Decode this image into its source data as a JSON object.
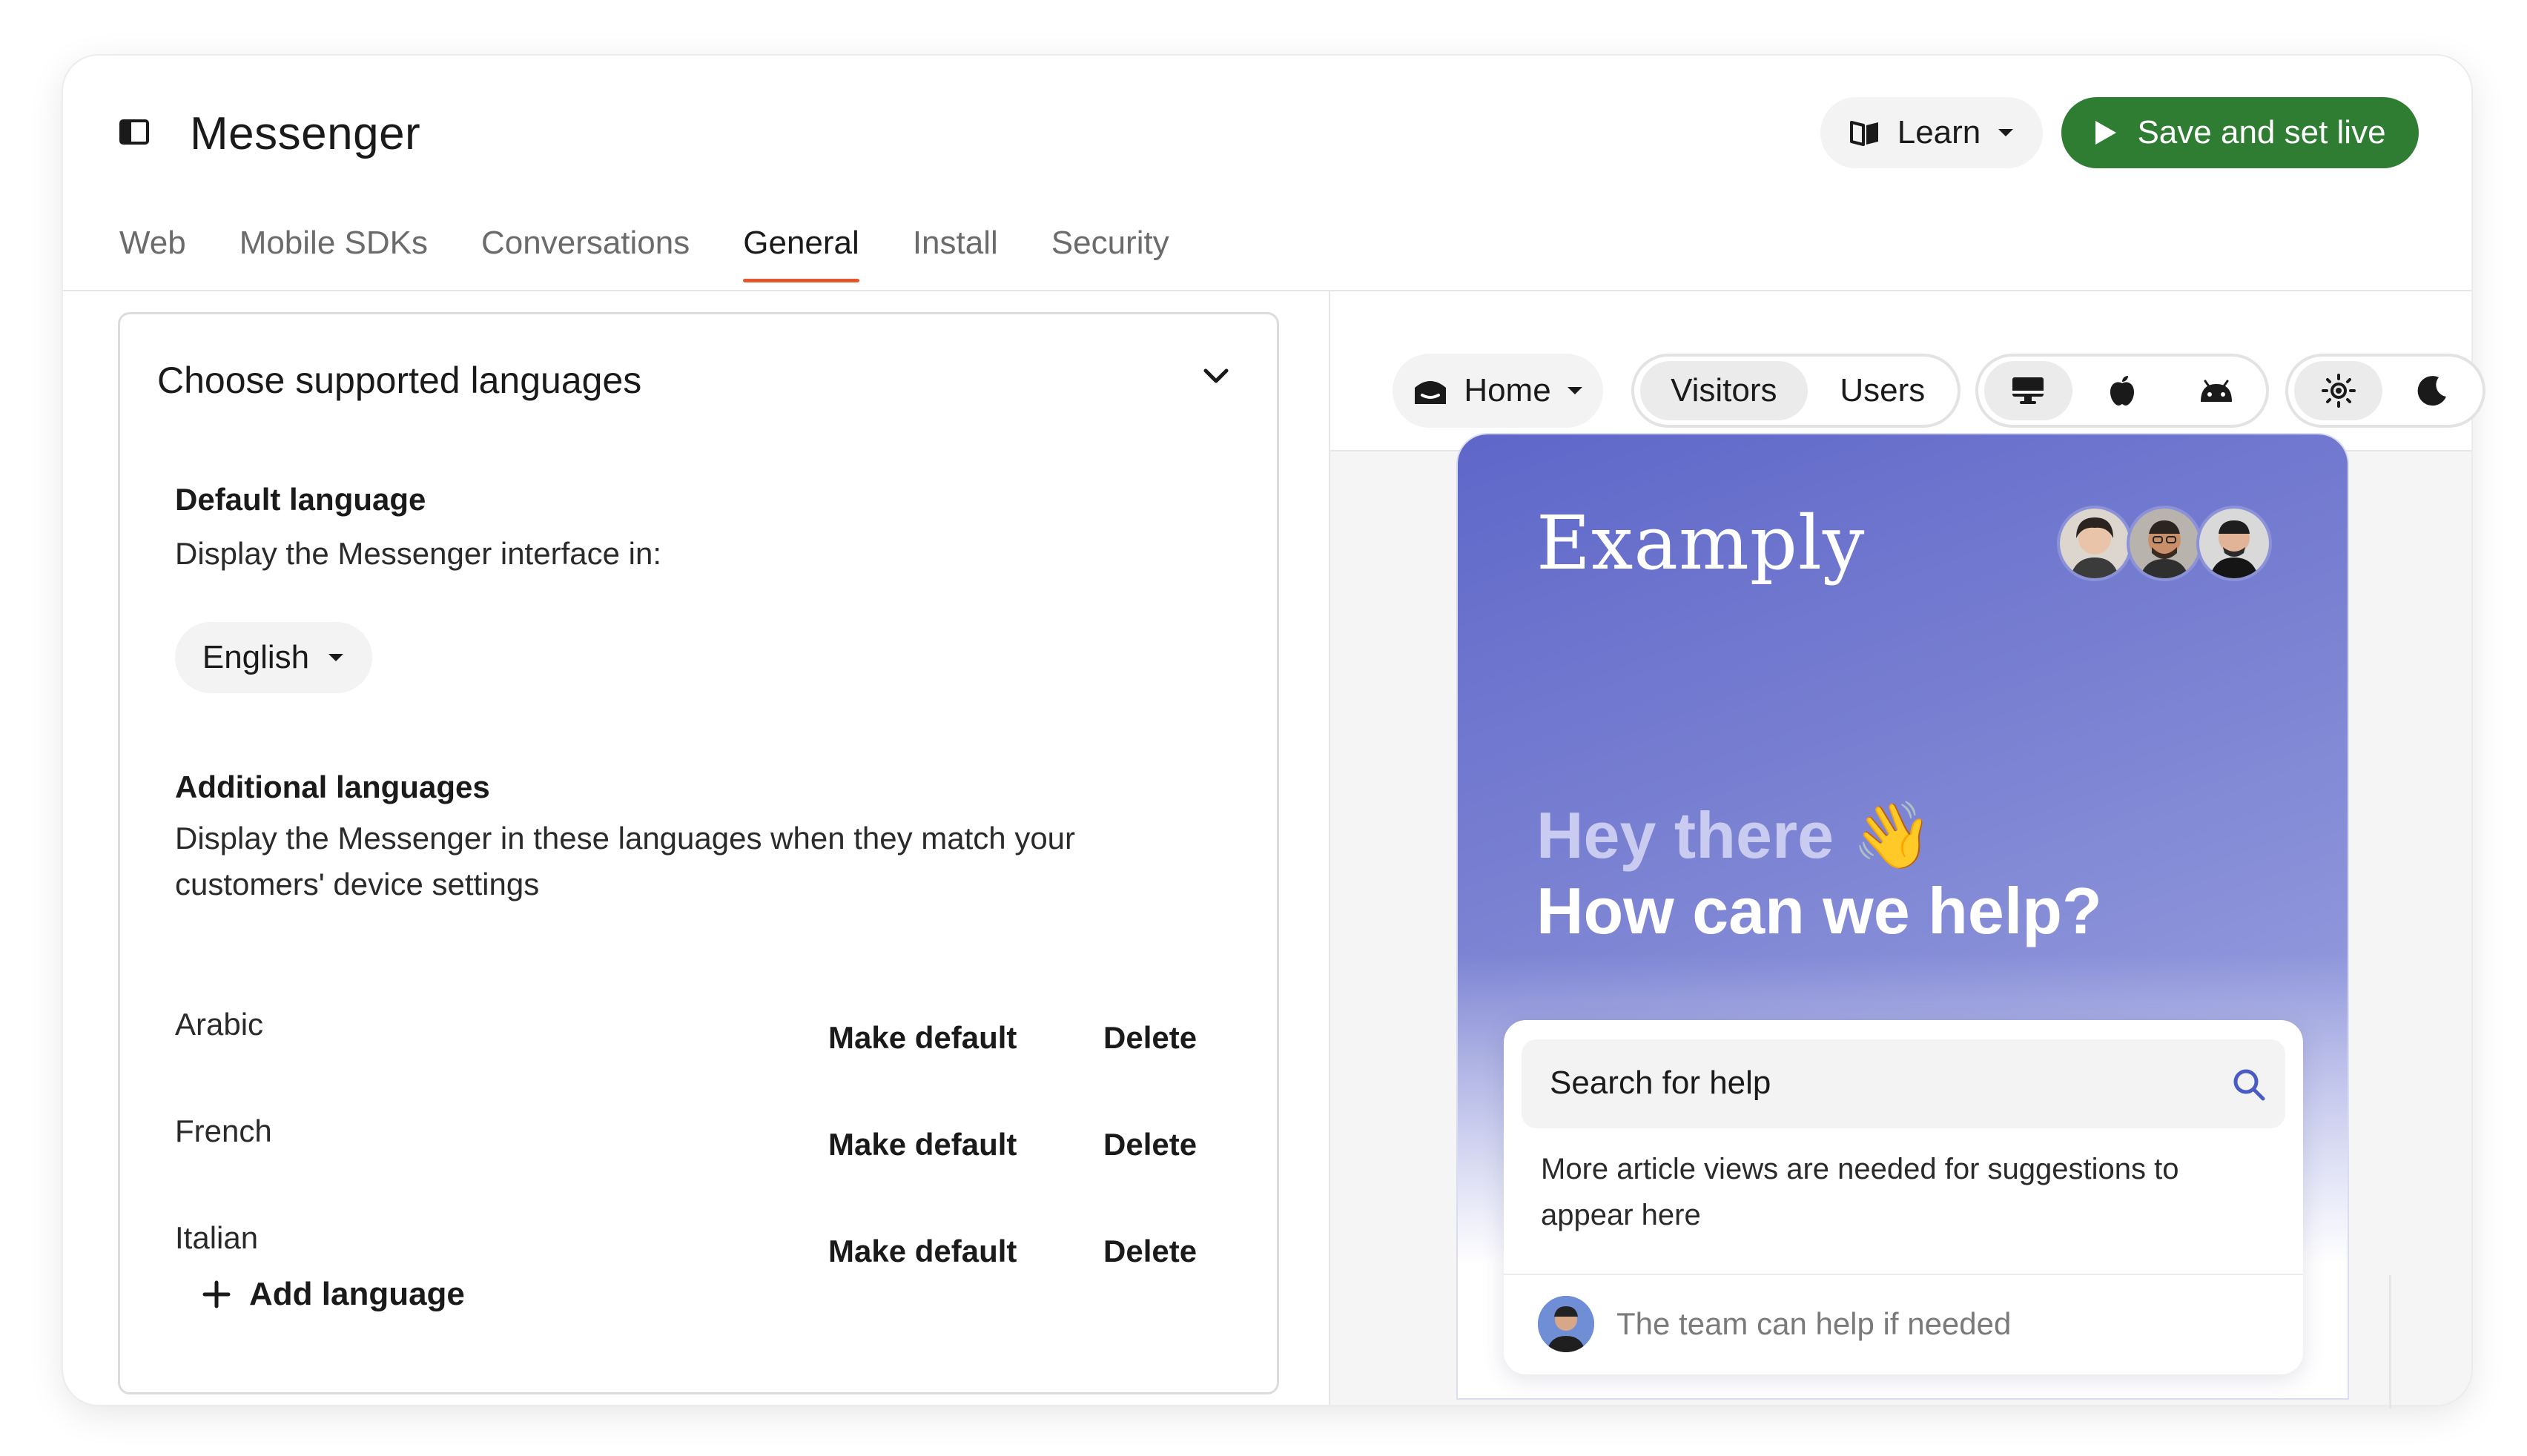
{
  "header": {
    "title": "Messenger",
    "learn_label": "Learn",
    "save_label": "Save and set live"
  },
  "tabs": [
    {
      "label": "Web"
    },
    {
      "label": "Mobile SDKs"
    },
    {
      "label": "Conversations"
    },
    {
      "label": "General",
      "active": true
    },
    {
      "label": "Install"
    },
    {
      "label": "Security"
    }
  ],
  "languages_panel": {
    "title": "Choose supported languages",
    "default_heading": "Default language",
    "default_desc": "Display the Messenger interface in:",
    "default_value": "English",
    "additional_heading": "Additional languages",
    "additional_desc": "Display the Messenger in these languages when they match your customers' device settings",
    "languages": [
      {
        "name": "Arabic",
        "make_default": "Make default",
        "delete": "Delete"
      },
      {
        "name": "French",
        "make_default": "Make default",
        "delete": "Delete"
      },
      {
        "name": "Italian",
        "make_default": "Make default",
        "delete": "Delete"
      }
    ],
    "add_label": "Add language"
  },
  "preview_toolbar": {
    "home_label": "Home",
    "audience": [
      "Visitors",
      "Users"
    ],
    "audience_selected": "Visitors",
    "platforms": [
      "desktop-icon",
      "apple-icon",
      "android-icon"
    ],
    "platform_selected": "desktop-icon",
    "themes": [
      "sun-icon",
      "moon-icon"
    ],
    "theme_selected": "sun-icon"
  },
  "messenger_preview": {
    "brand": "Examply",
    "greeting_line1": "Hey there 👋",
    "greeting_line2": "How can we help?",
    "search_label": "Search for help",
    "hint": "More article views are needed for suggestions to appear here",
    "team_text": "The team can help if needed",
    "gradient_start": "#5e67c9",
    "gradient_end": "#aab0e6"
  },
  "colors": {
    "accent_tab": "#e4572e",
    "primary_button": "#2e7d32"
  }
}
